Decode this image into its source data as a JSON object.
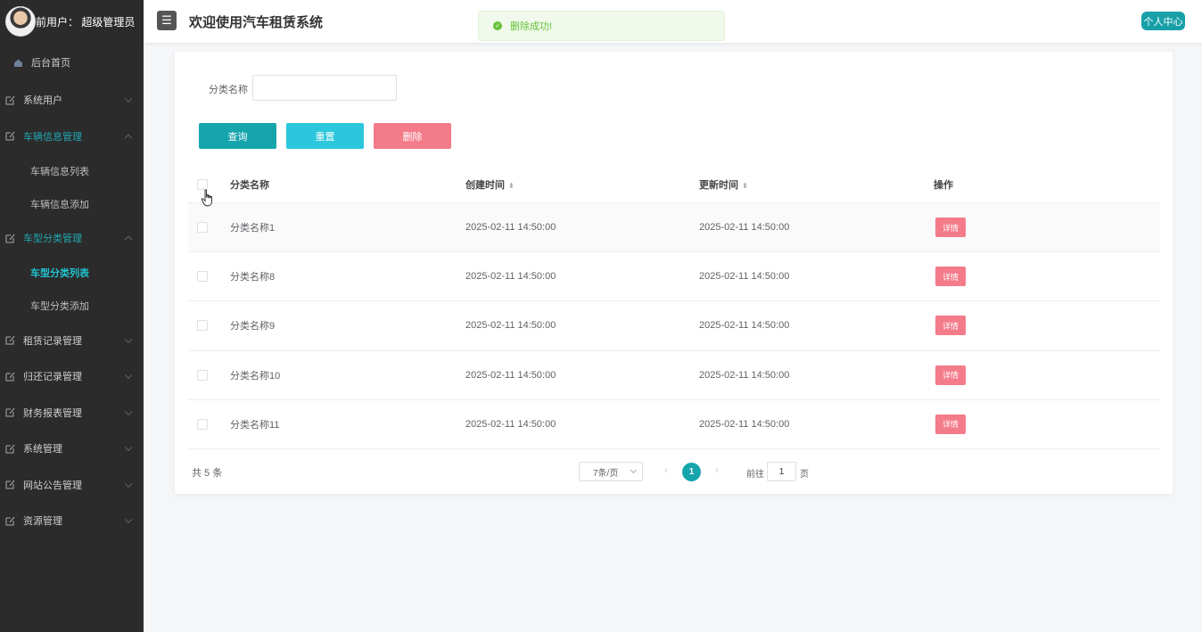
{
  "sidebar": {
    "user_label": "前用户：  超级管理员",
    "home": "后台首页",
    "items": [
      {
        "label": "系统用户"
      },
      {
        "label": "车辆信息管理"
      },
      {
        "label": "车型分类管理"
      },
      {
        "label": "租赁记录管理"
      },
      {
        "label": "归还记录管理"
      },
      {
        "label": "财务报表管理"
      },
      {
        "label": "系统管理"
      },
      {
        "label": "网站公告管理"
      },
      {
        "label": "资源管理"
      }
    ],
    "vehicle_sub": [
      "车辆信息列表",
      "车辆信息添加"
    ],
    "category_sub": [
      "车型分类列表",
      "车型分类添加"
    ]
  },
  "header": {
    "menu_icon": "☰",
    "title": "欢迎使用汽车租赁系统",
    "personal": "个人中心"
  },
  "toast": {
    "text": "删除成功!"
  },
  "search": {
    "label": "分类名称",
    "value": "",
    "placeholder": ""
  },
  "buttons": {
    "query": "查询",
    "reset": "重置",
    "delete": "删除"
  },
  "table": {
    "headers": [
      "分类名称",
      "创建时间",
      "更新时间",
      "操作"
    ],
    "rows": [
      {
        "name": "分类名称1",
        "created": "2025-02-11 14:50:00",
        "updated": "2025-02-11 14:50:00",
        "action": "详情"
      },
      {
        "name": "分类名称8",
        "created": "2025-02-11 14:50:00",
        "updated": "2025-02-11 14:50:00",
        "action": "详情"
      },
      {
        "name": "分类名称9",
        "created": "2025-02-11 14:50:00",
        "updated": "2025-02-11 14:50:00",
        "action": "详情"
      },
      {
        "name": "分类名称10",
        "created": "2025-02-11 14:50:00",
        "updated": "2025-02-11 14:50:00",
        "action": "详情"
      },
      {
        "name": "分类名称11",
        "created": "2025-02-11 14:50:00",
        "updated": "2025-02-11 14:50:00",
        "action": "详情"
      }
    ]
  },
  "pagination": {
    "total": "共 5 条",
    "page_size": "7条/页",
    "prev": "‹",
    "current": "1",
    "next": "›",
    "goto": "前往",
    "goto_value": "1",
    "unit": "页"
  },
  "colors": {
    "accent": "#17a5ad",
    "danger": "#f47b8a",
    "sidebar": "#2b2b2b"
  }
}
